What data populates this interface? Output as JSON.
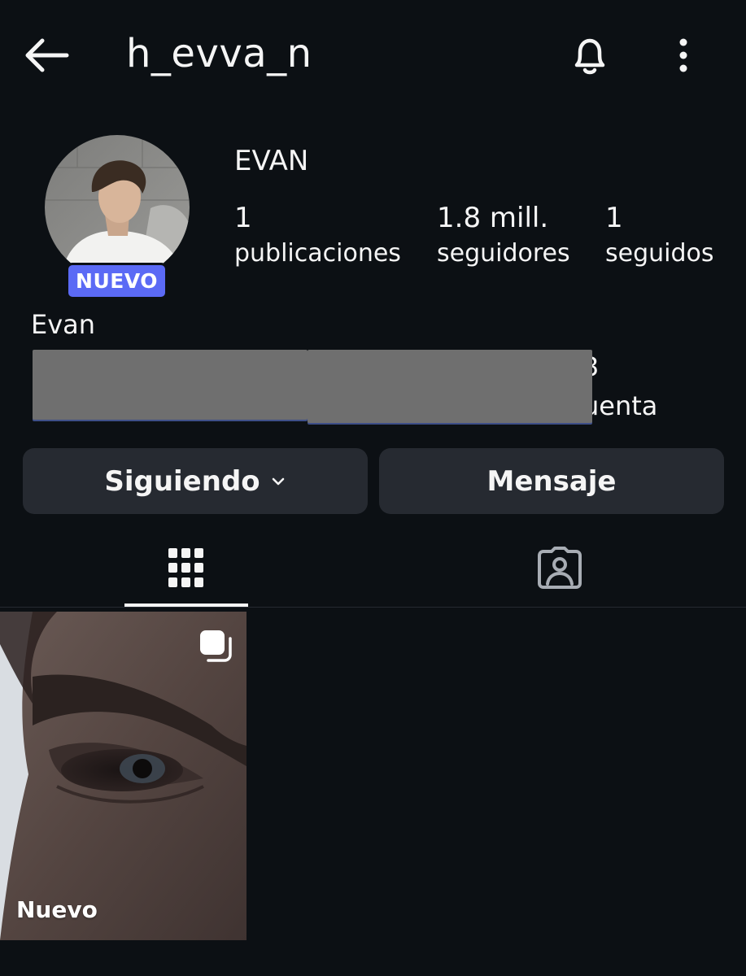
{
  "header": {
    "username": "h_evva_n",
    "back_icon": "back-arrow-icon",
    "bell_icon": "bell-icon",
    "more_icon": "more-vertical-icon"
  },
  "profile": {
    "badge": "NUEVO",
    "display_name": "EVAN",
    "stats": {
      "posts_count": "1",
      "posts_label": "publicaciones",
      "followers_count": "1.8 mill.",
      "followers_label": "seguidores",
      "following_count": "1",
      "following_label": "seguidos"
    },
    "bio_name": "Evan",
    "bio_fragment_number": "3",
    "bio_fragment_text": "uenta"
  },
  "actions": {
    "following_label": "Siguiendo",
    "message_label": "Mensaje"
  },
  "tabs": {
    "grid_icon": "grid-icon",
    "tagged_icon": "tagged-person-icon"
  },
  "posts": [
    {
      "label": "Nuevo",
      "icon": "carousel-icon"
    }
  ],
  "colors": {
    "background": "#0c1014",
    "button": "#262a31",
    "badge": "#5b6af5",
    "text": "#f5f5f5"
  }
}
